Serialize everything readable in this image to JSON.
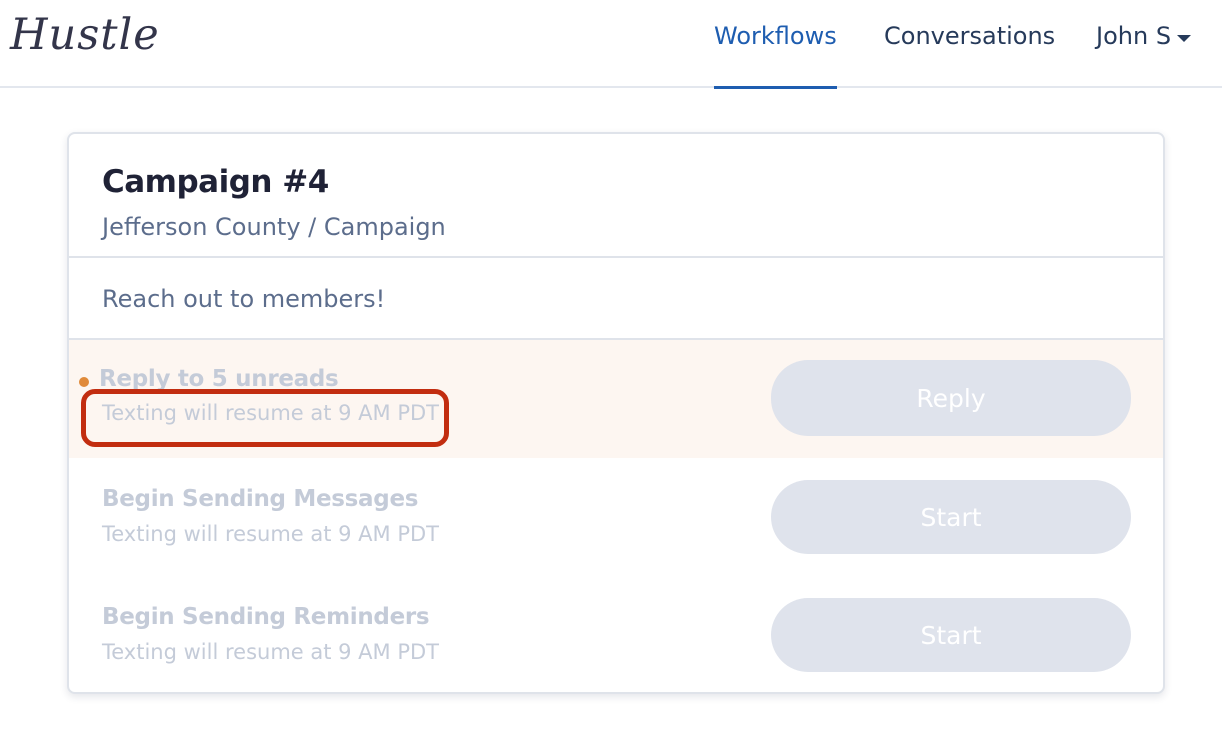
{
  "header": {
    "logo": "Hustle",
    "nav": [
      {
        "label": "Workflows",
        "active": true
      },
      {
        "label": "Conversations",
        "active": false
      }
    ],
    "user": {
      "label": "John S"
    }
  },
  "card": {
    "title": "Campaign #4",
    "subtitle": "Jefferson County / Campaign",
    "description": "Reach out to members!",
    "tasks": [
      {
        "title": "Reply to 5 unreads",
        "status": "Texting will resume at 9 AM PDT",
        "button": "Reply",
        "unread_indicator": true
      },
      {
        "title": "Begin Sending Messages",
        "status": "Texting will resume at 9 AM PDT",
        "button": "Start"
      },
      {
        "title": "Begin Sending Reminders",
        "status": "Texting will resume at 9 AM PDT",
        "button": "Start"
      }
    ]
  },
  "colors": {
    "accent": "#1e5db0",
    "annotation": "#c22d10",
    "unread_dot": "#e08a3a",
    "disabled_button": "#dfe3ec"
  }
}
